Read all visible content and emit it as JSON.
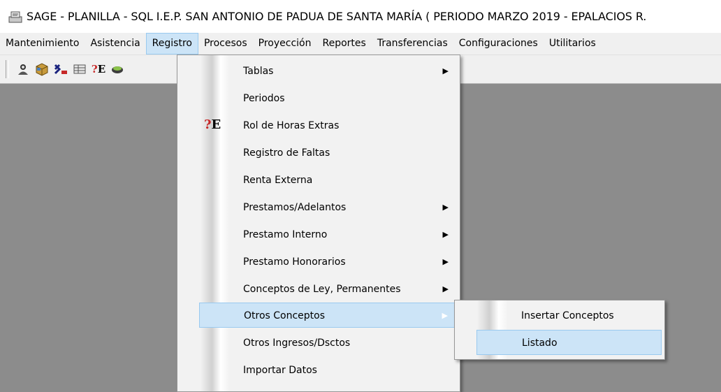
{
  "window": {
    "title": "SAGE - PLANILLA - SQL  I.E.P. SAN ANTONIO DE PADUA DE SANTA MARÍA ( PERIODO MARZO 2019 - EPALACIOS  R."
  },
  "menubar": {
    "items": [
      "Mantenimiento",
      "Asistencia",
      "Registro",
      "Procesos",
      "Proyección",
      "Reportes",
      "Transferencias",
      "Configuraciones",
      "Utilitarios"
    ]
  },
  "toolbar": {
    "icons": [
      "employee-icon",
      "package-icon",
      "excel-icon",
      "table-icon",
      "extra-hours-icon",
      "book-icon"
    ]
  },
  "registro_menu": {
    "items": [
      {
        "label": "Tablas",
        "has_submenu": true
      },
      {
        "label": "Periodos",
        "has_submenu": false
      },
      {
        "label": "Rol de Horas Extras",
        "has_submenu": false,
        "icon": "extra-hours-icon"
      },
      {
        "label": "Registro de Faltas",
        "has_submenu": false
      },
      {
        "label": "Renta Externa",
        "has_submenu": false
      },
      {
        "label": "Prestamos/Adelantos",
        "has_submenu": true
      },
      {
        "label": "Prestamo Interno",
        "has_submenu": true
      },
      {
        "label": "Prestamo Honorarios",
        "has_submenu": true
      },
      {
        "label": "Conceptos de Ley, Permanentes",
        "has_submenu": true
      },
      {
        "label": "Otros Conceptos",
        "has_submenu": true,
        "highlighted": true
      },
      {
        "label": "Otros Ingresos/Dsctos",
        "has_submenu": false
      },
      {
        "label": "Importar Datos",
        "has_submenu": false
      }
    ]
  },
  "otros_conceptos_submenu": {
    "items": [
      {
        "label": "Insertar Conceptos"
      },
      {
        "label": "Listado",
        "highlighted": true
      }
    ]
  },
  "icon_glyphs": {
    "extra_hours": "?E"
  },
  "colors": {
    "highlight_bg": "#cce4f7",
    "highlight_border": "#99c9ef",
    "workspace": "#8c8c8c"
  }
}
